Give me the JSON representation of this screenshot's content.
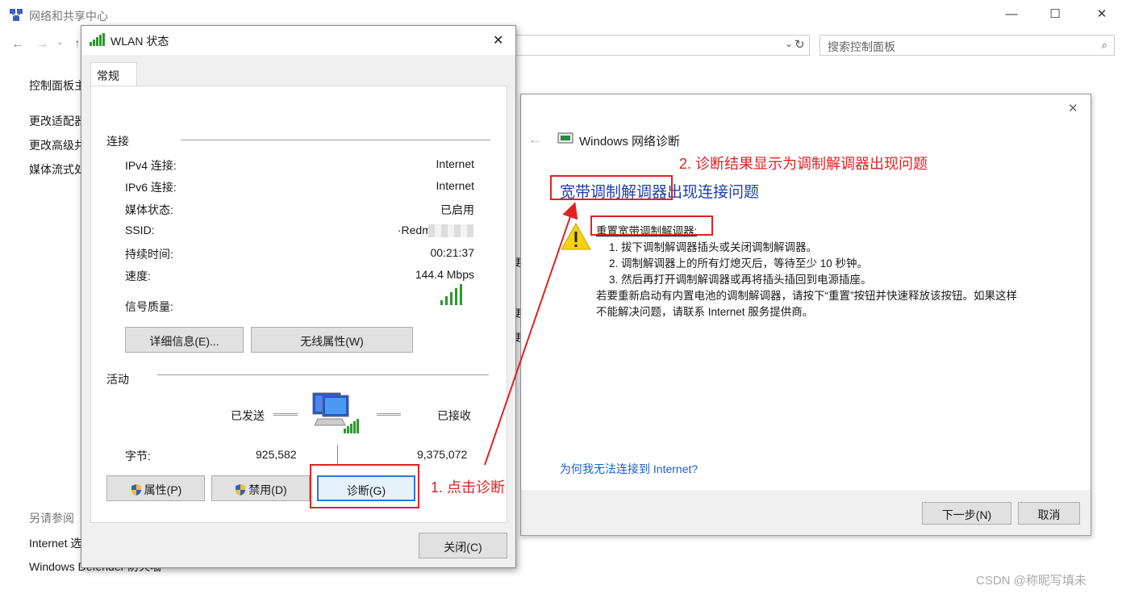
{
  "main": {
    "title": "网络和共享中心",
    "search_placeholder": "搜索控制面板",
    "sidebar_links": [
      "控制面板主",
      "更改适配器",
      "更改高级共",
      "媒体流式处"
    ],
    "see_also": "另请参阅",
    "see_also_links": [
      "Internet 选",
      "Windows Defender 防火墙"
    ],
    "partial_texts": [
      "更",
      "更",
      "更"
    ]
  },
  "wlan": {
    "title": "WLAN 状态",
    "tab": "常规",
    "connection_header": "连接",
    "rows": [
      {
        "label": "IPv4 连接:",
        "value": "Internet"
      },
      {
        "label": "IPv6 连接:",
        "value": "Internet"
      },
      {
        "label": "媒体状态:",
        "value": "已启用"
      },
      {
        "label": "SSID:",
        "value": "·Redmi"
      },
      {
        "label": "持续时间:",
        "value": "00:21:37"
      },
      {
        "label": "速度:",
        "value": "144.4 Mbps"
      }
    ],
    "signal_label": "信号质量:",
    "signal_level": 1.0,
    "details_button": "详细信息(E)...",
    "wireless_button": "无线属性(W)",
    "activity_header": "活动",
    "sent_label": "已发送",
    "received_label": "已接收",
    "bytes_label": "字节:",
    "bytes_sent": "925,582",
    "bytes_received": "9,375,072",
    "properties_button": "属性(P)",
    "disable_button": "禁用(D)",
    "diagnose_button": "诊断(G)",
    "close_button": "关闭(C)"
  },
  "diag": {
    "title": "Windows 网络诊断",
    "problem_part1": "宽带调制解调器",
    "problem_part2": "出现连接问题",
    "fix_title": "重置宽带调制解调器:",
    "steps": [
      "1.  拔下调制解调器插头或关闭调制解调器。",
      "2.  调制解调器上的所有灯熄灭后，等待至少 10 秒钟。",
      "3.  然后再打开调制解调器或再将插头插回到电源插座。"
    ],
    "note_line1": "若要重新启动有内置电池的调制解调器，请按下“重置”按钮并快速释放该按钮。如果这样",
    "note_line2": "不能解决问题，请联系 Internet 服务提供商。",
    "help_link": "为何我无法连接到 Internet?",
    "next_button": "下一步(N)",
    "cancel_button": "取消"
  },
  "annotations": {
    "step1": "1. 点击诊断",
    "step2": "2. 诊断结果显示为调制解调器出现问题",
    "color": "#e02222"
  },
  "watermark": "CSDN @称昵写填未"
}
